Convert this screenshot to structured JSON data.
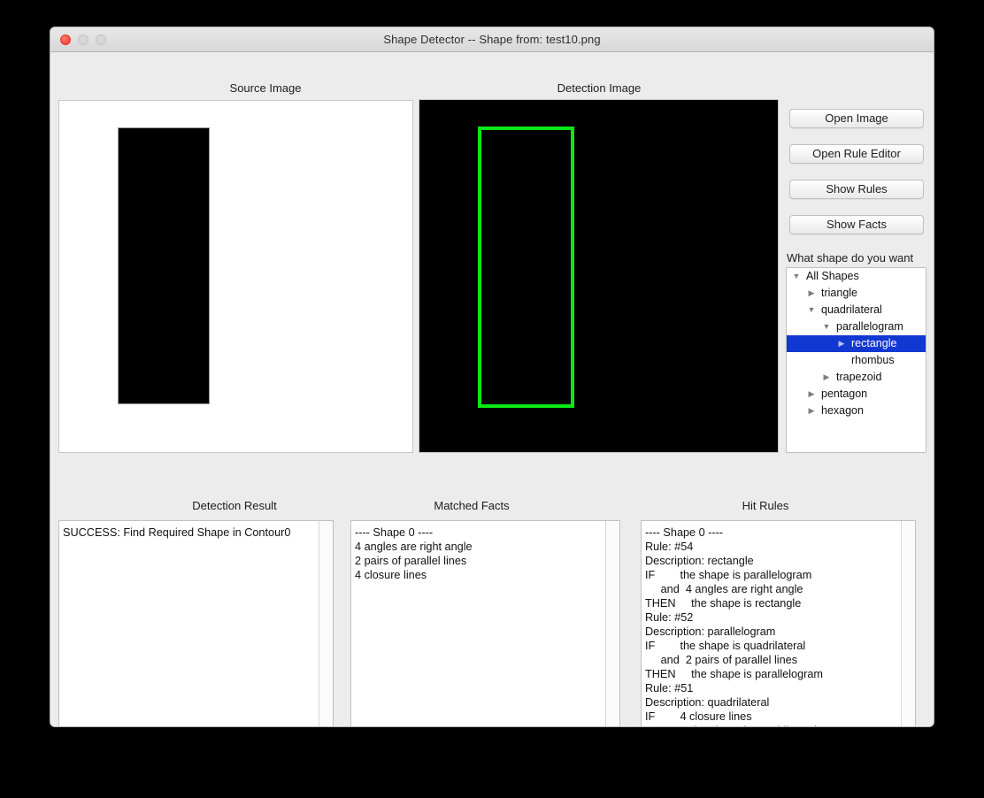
{
  "window": {
    "title": "Shape Detector -- Shape from: test10.png",
    "traffic_lights": [
      "close",
      "minimize",
      "zoom"
    ]
  },
  "labels": {
    "source_image": "Source Image",
    "detection_image": "Detection Image",
    "detection_result": "Detection Result",
    "matched_facts": "Matched Facts",
    "hit_rules": "Hit Rules"
  },
  "buttons": [
    {
      "label": "Open Image"
    },
    {
      "label": "Open Rule Editor"
    },
    {
      "label": "Show Rules"
    },
    {
      "label": "Show Facts"
    }
  ],
  "tree": {
    "title": "What shape do you want",
    "items": [
      {
        "label": "All Shapes",
        "depth": 0,
        "twisty": "expanded",
        "selected": false
      },
      {
        "label": "triangle",
        "depth": 1,
        "twisty": "collapsed",
        "selected": false
      },
      {
        "label": "quadrilateral",
        "depth": 1,
        "twisty": "expanded",
        "selected": false
      },
      {
        "label": "parallelogram",
        "depth": 2,
        "twisty": "expanded",
        "selected": false
      },
      {
        "label": "rectangle",
        "depth": 3,
        "twisty": "collapsed",
        "selected": true
      },
      {
        "label": "rhombus",
        "depth": 3,
        "twisty": "none",
        "selected": false
      },
      {
        "label": "trapezoid",
        "depth": 2,
        "twisty": "collapsed",
        "selected": false
      },
      {
        "label": "pentagon",
        "depth": 1,
        "twisty": "collapsed",
        "selected": false
      },
      {
        "label": "hexagon",
        "depth": 1,
        "twisty": "collapsed",
        "selected": false
      }
    ]
  },
  "panels": {
    "detection_result_text": "SUCCESS: Find Required Shape in Contour0",
    "matched_facts_text": "---- Shape 0 ----\n4 angles are right angle\n2 pairs of parallel lines\n4 closure lines",
    "hit_rules_text": "---- Shape 0 ----\nRule: #54\nDescription: rectangle\nIF        the shape is parallelogram\n     and  4 angles are right angle\nTHEN     the shape is rectangle\nRule: #52\nDescription: parallelogram\nIF        the shape is quadrilateral\n     and  2 pairs of parallel lines\nTHEN     the shape is parallelogram\nRule: #51\nDescription: quadrilateral\nIF        4 closure lines\nTHEN     the shape is quadrilateral"
  },
  "images": {
    "source": {
      "background": "#ffffff",
      "shape_fill": "#000000"
    },
    "detection": {
      "background": "#000000",
      "outline_color": "#0ae817"
    }
  },
  "colors": {
    "window_background": "#ececec",
    "selection_blue": "#1238d2",
    "detection_green": "#0ae817",
    "close_red": "#f34a3c"
  }
}
